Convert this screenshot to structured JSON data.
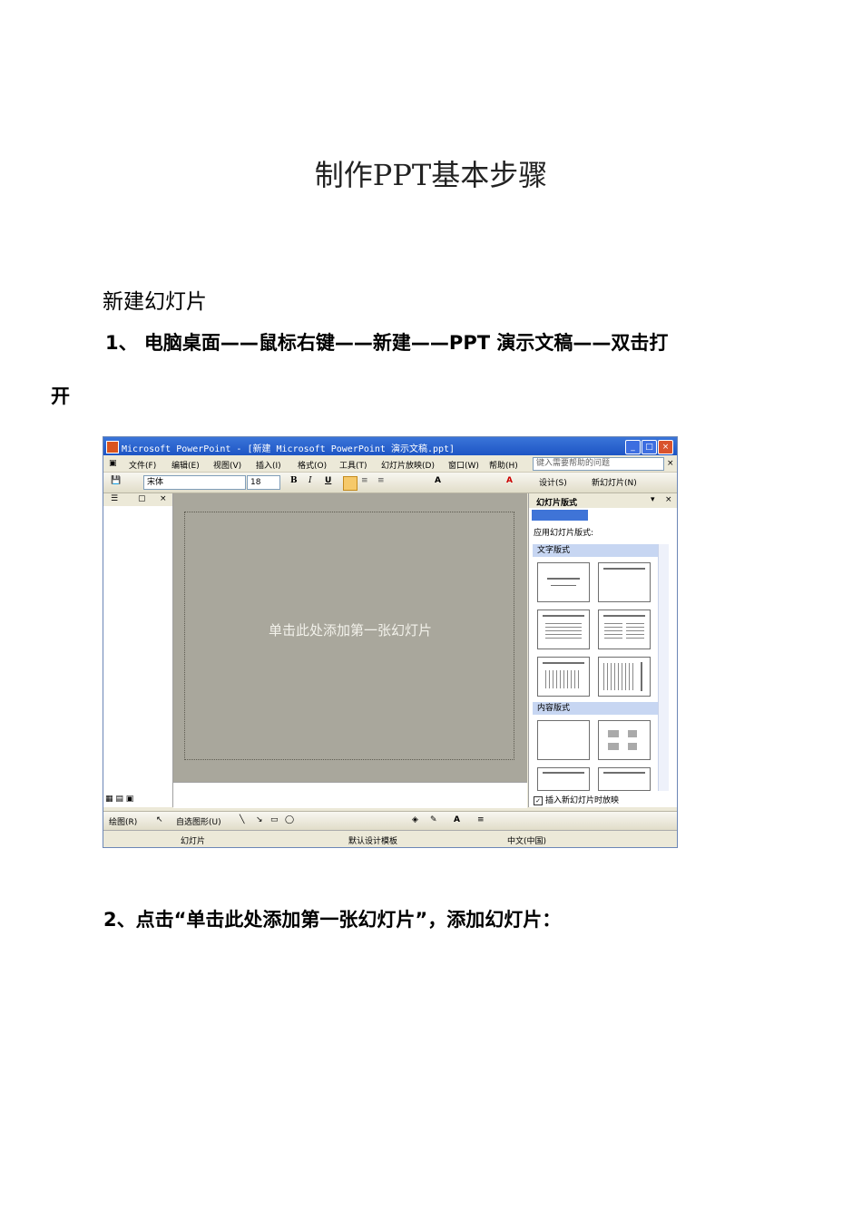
{
  "doc": {
    "title": "制作PPT基本步骤",
    "subtitle": "新建幻灯片",
    "step1_line1": "1、 电脑桌面——鼠标右键——新建——PPT 演示文稿——双击打",
    "step1_line2": "开",
    "step2": "2、点击“单击此处添加第一张幻灯片”，添加幻灯片："
  },
  "screenshot": {
    "window_title": "Microsoft PowerPoint - [新建 Microsoft PowerPoint 演示文稿.ppt]",
    "window_buttons": {
      "minimize": "_",
      "maximize": "□",
      "close": "×"
    },
    "menu": [
      "文件(F)",
      "编辑(E)",
      "视图(V)",
      "插入(I)",
      "格式(O)",
      "工具(T)",
      "幻灯片放映(D)",
      "窗口(W)",
      "帮助(H)"
    ],
    "help_placeholder": "键入需要帮助的问题",
    "font_name": "宋体",
    "font_size": "18",
    "format_buttons": {
      "bold": "B",
      "italic": "I",
      "underline": "U"
    },
    "design_button": "设计(S)",
    "new_slide_button": "新幻灯片(N)",
    "slide_placeholder": "单击此处添加第一张幻灯片",
    "task_pane": {
      "title": "幻灯片版式",
      "apply_label": "应用幻灯片版式:",
      "section_text": "文字版式",
      "section_content": "内容版式",
      "checkbox_label": "插入新幻灯片时放映"
    },
    "drawing_label": "绘图(R)",
    "autoshape_label": "自选图形(U)",
    "status": {
      "slide": "幻灯片",
      "template": "默认设计模板",
      "language": "中文(中国)"
    }
  }
}
